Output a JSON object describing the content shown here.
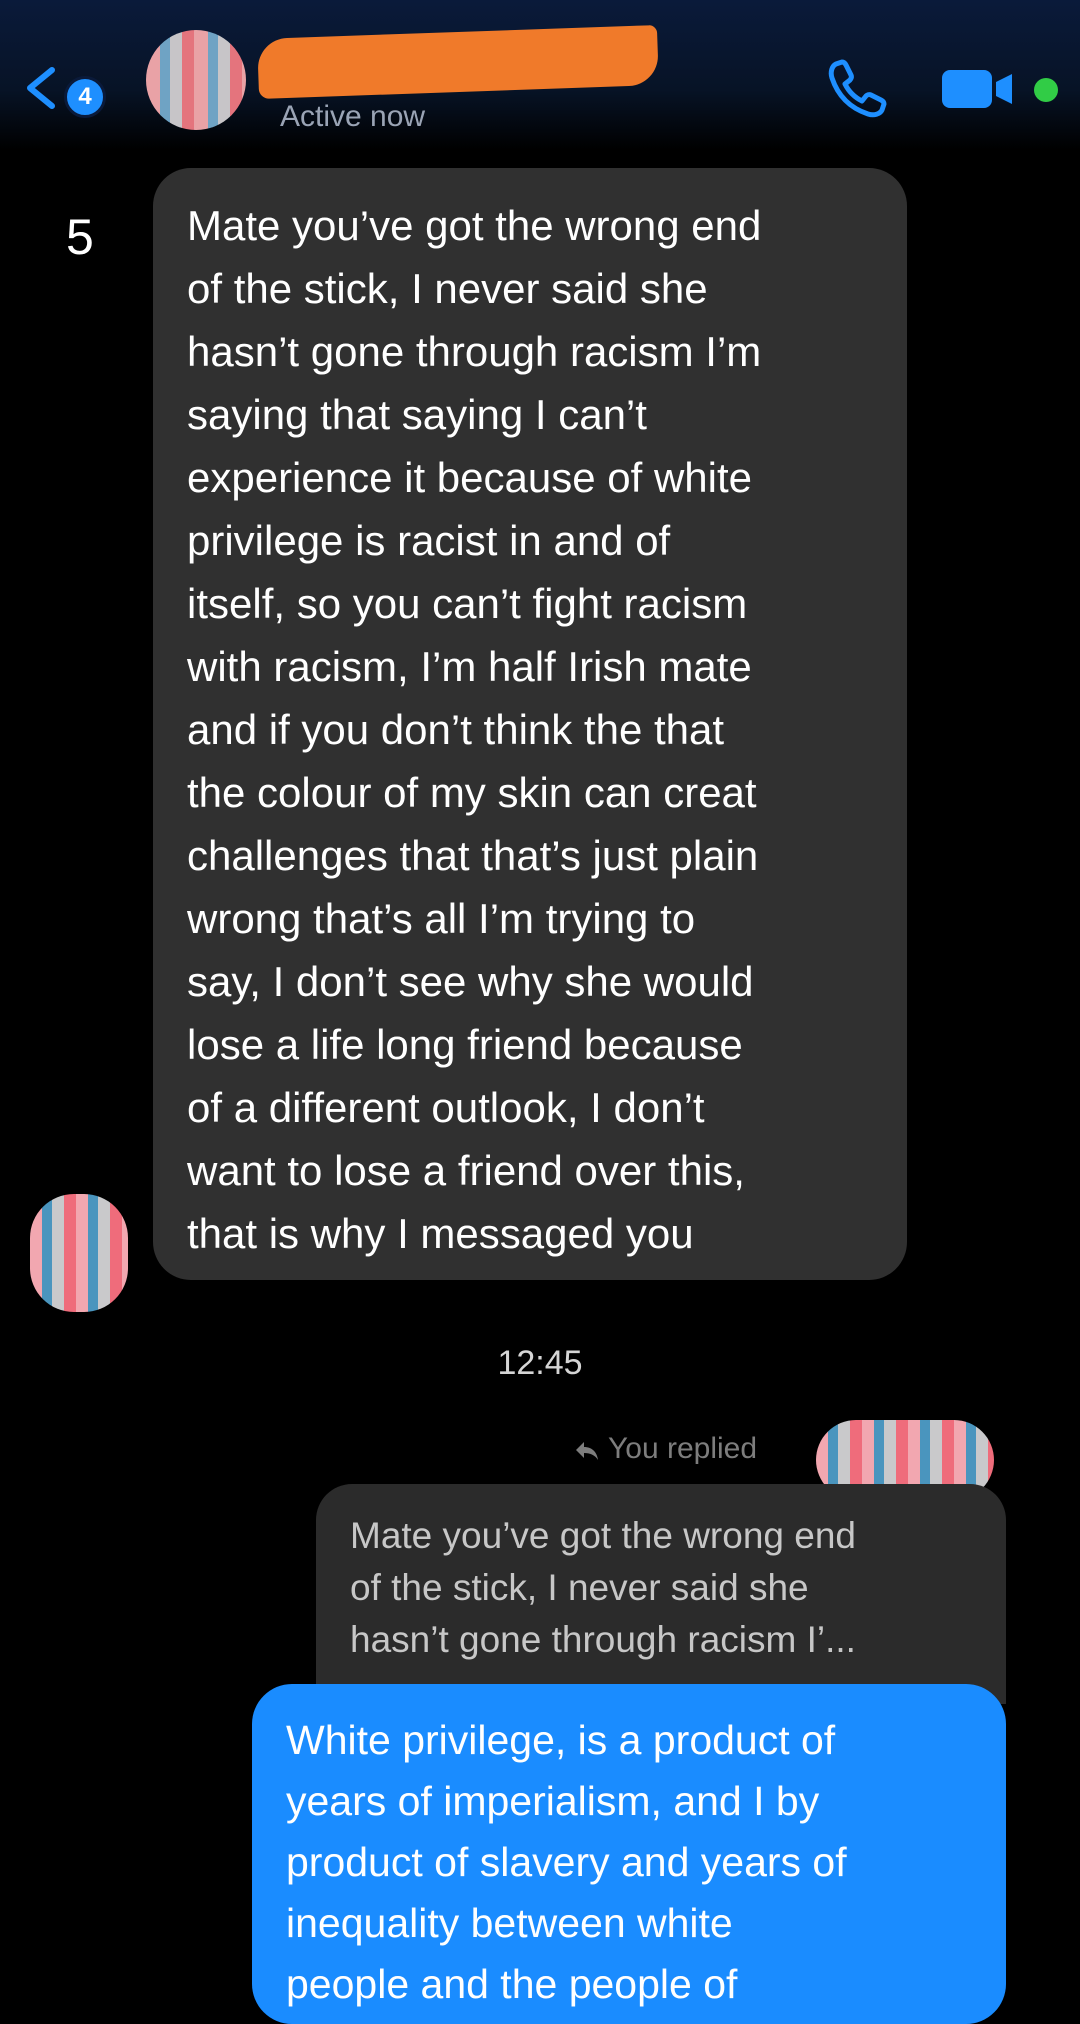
{
  "header": {
    "back_count": "4",
    "status": "Active now",
    "icons": {
      "back": "chevron-left-icon",
      "phone": "phone-icon",
      "video": "video-camera-icon"
    },
    "colors": {
      "accent": "#1e8fff",
      "active_dot": "#31cc46",
      "redaction": "#f07a2a"
    }
  },
  "conversation": {
    "unread_marker": "5",
    "incoming_message": "Mate you’ve got the wrong end\nof the stick, I never said she\nhasn’t gone through racism I’m\nsaying that saying I can’t\nexperience it because of white\nprivilege is racist in and of\nitself, so you can’t fight racism\nwith racism, I’m half Irish mate\nand if you don’t think the that\nthe colour of my skin can creat\nchallenges that that’s just plain\nwrong that’s all I’m trying to\nsay, I don’t see why she would\nlose a life long friend because\nof a different outlook, I don’t\nwant to lose a friend over this,\nthat is why I messaged you",
    "timestamp": "12:45",
    "reply_label": "You replied",
    "quoted_message": "Mate you’ve got the wrong end\nof the stick, I never said she\nhasn’t gone through racism I’...",
    "outgoing_message": "White privilege, is a product of\nyears of imperialism, and I by\nproduct of slavery and years of\ninequality between white\npeople and the people of"
  }
}
